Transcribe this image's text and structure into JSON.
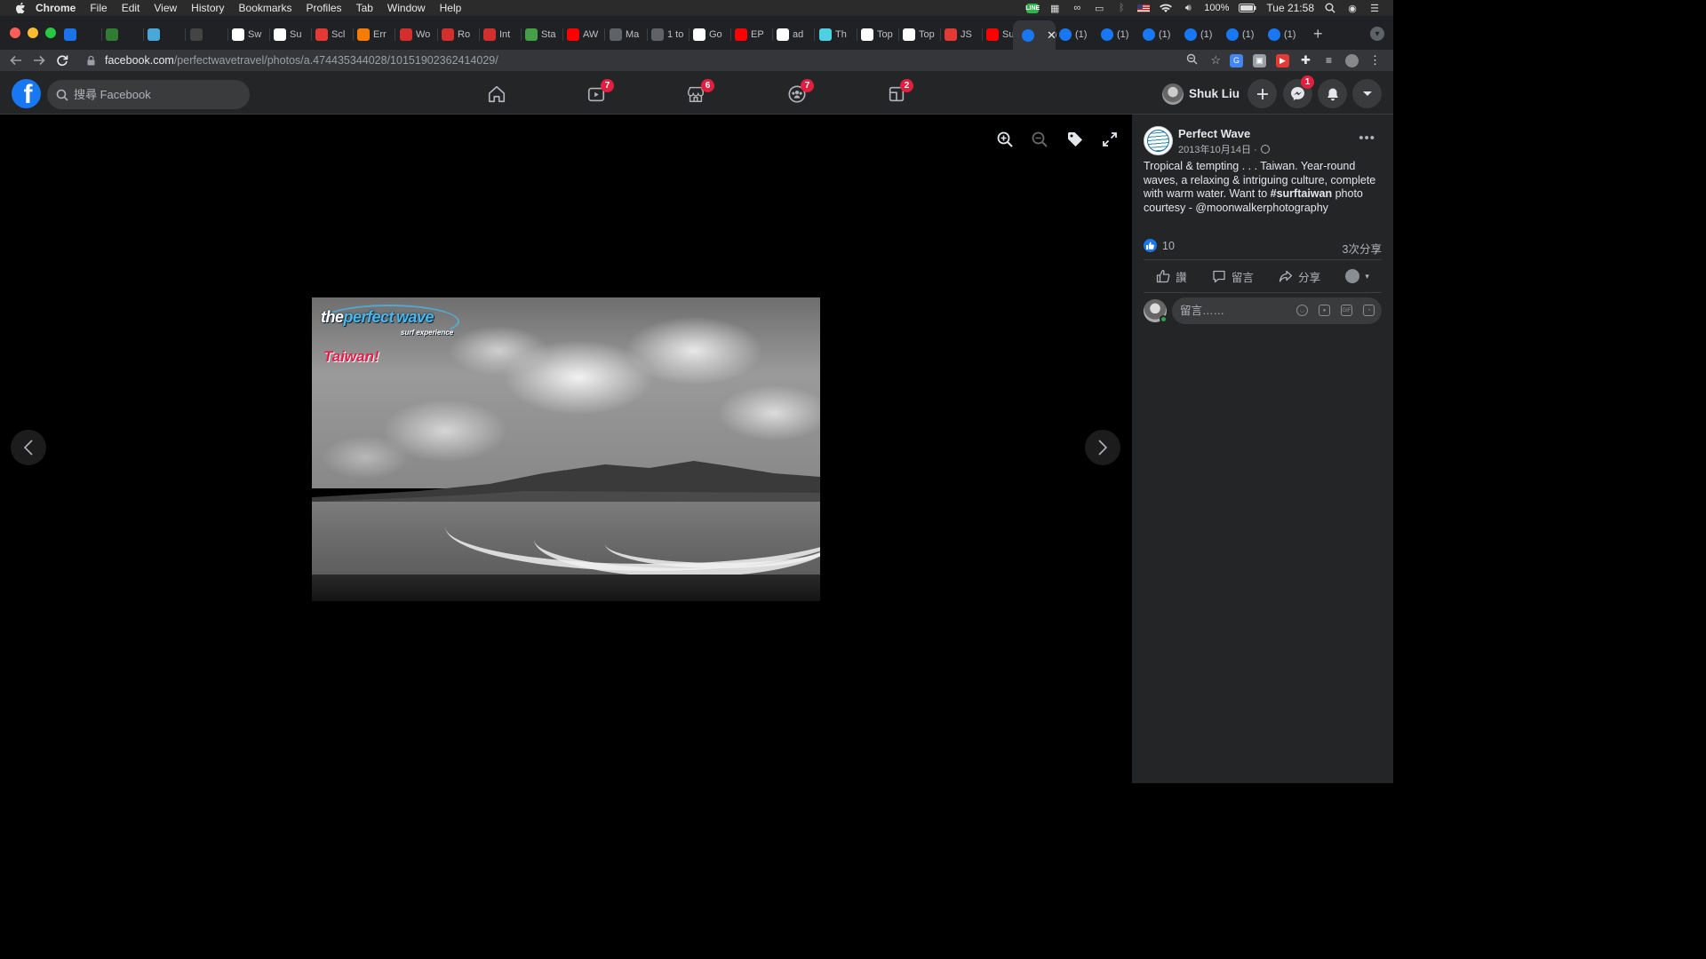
{
  "menubar": {
    "app_name": "Chrome",
    "items": [
      "File",
      "Edit",
      "View",
      "History",
      "Bookmarks",
      "Profiles",
      "Tab",
      "Window",
      "Help"
    ],
    "battery": "100%",
    "clock": "Tue 21:58"
  },
  "tabs": [
    {
      "label": "",
      "icon": "sheets-icon",
      "color": "#1a73e8"
    },
    {
      "label": "",
      "icon": "ae-icon",
      "color": "#2e7d32"
    },
    {
      "label": "",
      "icon": "photo-icon",
      "color": "#4aa8d8"
    },
    {
      "label": "",
      "icon": "openai-icon",
      "color": "#444"
    },
    {
      "label": "Sw",
      "icon": "wikipedia-icon",
      "color": "#ffffff"
    },
    {
      "label": "Su",
      "icon": "wikipedia-icon",
      "color": "#ffffff"
    },
    {
      "label": "Scl",
      "icon": "mountain-icon",
      "color": "#e53935"
    },
    {
      "label": "Err",
      "icon": "arrow-icon",
      "color": "#f57c00"
    },
    {
      "label": "Wo",
      "icon": "maple-leaf-icon",
      "color": "#d32f2f"
    },
    {
      "label": "Ro",
      "icon": "maple-leaf-icon",
      "color": "#d32f2f"
    },
    {
      "label": "Int",
      "icon": "maple-leaf-icon",
      "color": "#d32f2f"
    },
    {
      "label": "Sta",
      "icon": "chart-icon",
      "color": "#43a047"
    },
    {
      "label": "AW",
      "icon": "youtube-icon",
      "color": "#ff0000"
    },
    {
      "label": "Ma",
      "icon": "globe-icon",
      "color": "#5f6368"
    },
    {
      "label": "1 to",
      "icon": "globe-icon",
      "color": "#5f6368"
    },
    {
      "label": "Go",
      "icon": "github-icon",
      "color": "#ffffff"
    },
    {
      "label": "EP",
      "icon": "youtube-icon",
      "color": "#ff0000"
    },
    {
      "label": "ad",
      "icon": "github-icon",
      "color": "#ffffff"
    },
    {
      "label": "Th",
      "icon": "doc-icon",
      "color": "#4dd0e1"
    },
    {
      "label": "Top",
      "icon": "medium-icon",
      "color": "#ffffff"
    },
    {
      "label": "Top",
      "icon": "medium-icon",
      "color": "#ffffff"
    },
    {
      "label": "JS",
      "icon": "shield-icon",
      "color": "#e53935"
    },
    {
      "label": "Su",
      "icon": "youtube-icon",
      "color": "#ff0000"
    },
    {
      "label": "(1)",
      "icon": "facebook-icon",
      "color": "#1877f2"
    }
  ],
  "active_tab": {
    "icon": "facebook-icon",
    "close": "✕"
  },
  "tabs_after": [
    {
      "label": "(1)"
    },
    {
      "label": "(1)"
    },
    {
      "label": "(1)"
    },
    {
      "label": "(1)"
    },
    {
      "label": "(1)"
    },
    {
      "label": "(1)"
    }
  ],
  "address": {
    "host": "facebook.com",
    "path": "/perfectwavetravel/photos/a.474435344028/10151902362414029/"
  },
  "fb": {
    "search_placeholder": "搜尋 Facebook",
    "badges": {
      "watch": "7",
      "marketplace": "6",
      "groups": "7",
      "gaming": "2",
      "messenger": "1"
    },
    "user_name": "Shuk Liu"
  },
  "photo": {
    "brand_the": "the",
    "brand_perfect": "perfect",
    "brand_wave": "wave",
    "brand_sub": "surf experience",
    "country": "Taiwan!"
  },
  "post": {
    "page_name": "Perfect Wave",
    "date": "2013年10月14日 ·",
    "caption_before": "Tropical & tempting . . . Taiwan. Year-round waves, a relaxing & intriguing culture, complete with warm water. Want to ",
    "caption_hashtag": "#surftaiwan",
    "caption_after": " photo courtesy - @moonwalkerphotography",
    "reaction_count": "10",
    "shares": "3次分享",
    "like_label": "讚",
    "comment_label": "留言",
    "share_label": "分享",
    "comment_placeholder": "留言……"
  }
}
